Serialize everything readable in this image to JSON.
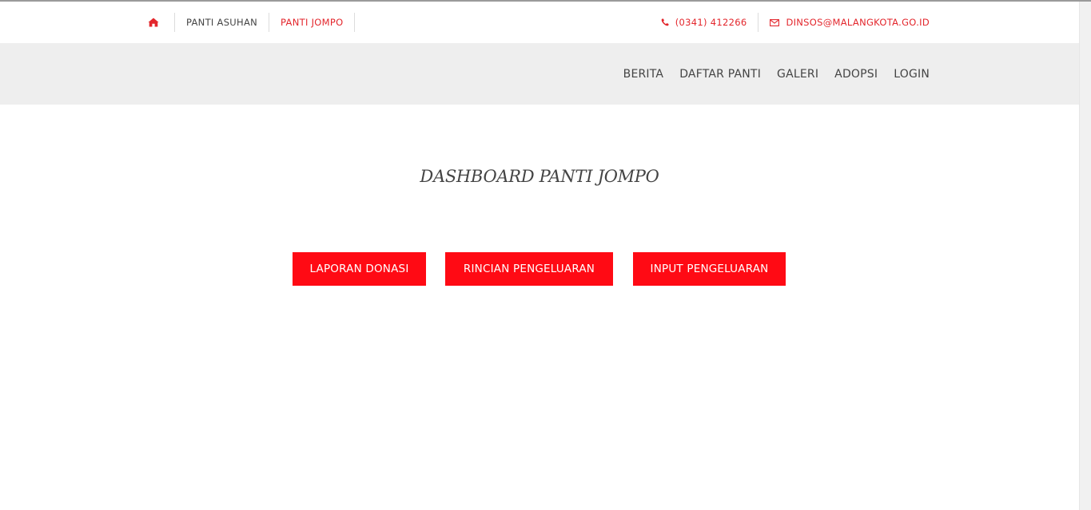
{
  "topbar": {
    "home_icon": "home-icon",
    "links": [
      "PANTI ASUHAN",
      "PANTI JOMPO"
    ],
    "phone_icon": "phone-icon",
    "phone": "(0341) 412266",
    "mail_icon": "envelope-icon",
    "email": "DINSOS@MALANGKOTA.GO.ID"
  },
  "nav": {
    "items": [
      "BERITA",
      "DAFTAR PANTI",
      "GALERI",
      "ADOPSI",
      "LOGIN"
    ]
  },
  "main": {
    "title": "DASHBOARD PANTI JOMPO",
    "buttons": [
      "LAPORAN DONASI",
      "RINCIAN PENGELUARAN",
      "INPUT PENGELUARAN"
    ]
  },
  "colors": {
    "accent": "#ff0a14",
    "link_red": "#e3262c",
    "nav_bg": "#eeeeee",
    "text": "#444444"
  }
}
